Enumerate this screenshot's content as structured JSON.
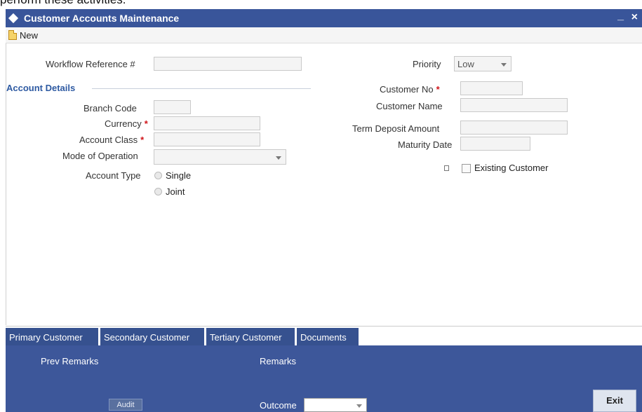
{
  "top_cut_text": "perform these activities.",
  "window": {
    "title": "Customer Accounts Maintenance",
    "minimize": "_",
    "close": "×"
  },
  "toolbar": {
    "new_label": "New"
  },
  "form": {
    "workflow_ref_label": "Workflow Reference #",
    "workflow_ref_value": "",
    "priority_label": "Priority",
    "priority_value": "Low",
    "account_details_title": "Account Details",
    "branch_code_label": "Branch Code",
    "currency_label": "Currency",
    "account_class_label": "Account Class",
    "mode_label": "Mode of Operation",
    "account_type_label": "Account Type",
    "radio_single": "Single",
    "radio_joint": "Joint",
    "customer_no_label": "Customer No",
    "customer_name_label": "Customer Name",
    "td_amount_label": "Term Deposit Amount",
    "maturity_label": "Maturity Date",
    "existing_customer_label": "Existing Customer",
    "required_mark": "*"
  },
  "tabs": [
    "Primary Customer",
    "Secondary Customer",
    "Tertiary Customer",
    "Documents"
  ],
  "footer": {
    "prev_remarks": "Prev Remarks",
    "remarks": "Remarks",
    "audit": "Audit",
    "outcome": "Outcome",
    "exit": "Exit"
  }
}
